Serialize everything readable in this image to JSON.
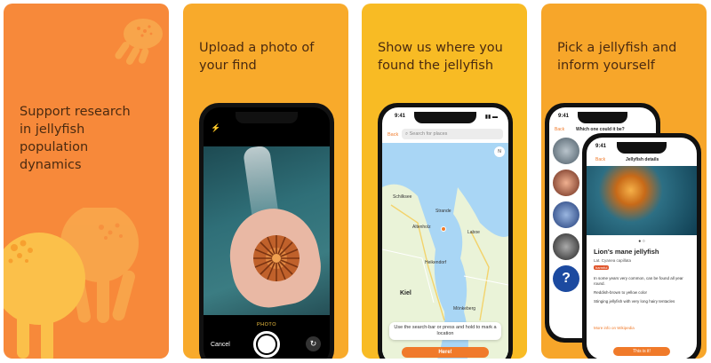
{
  "panel1": {
    "headline_lines": [
      "Support research",
      "in jellyfish",
      "population",
      "dynamics"
    ]
  },
  "panel2": {
    "headline_lines": [
      "Upload a photo of",
      "your find"
    ],
    "camera": {
      "mode_label": "PHOTO",
      "cancel_label": "Cancel",
      "flash_icon": "lightning-icon",
      "flip_icon": "camera-flip-icon"
    }
  },
  "panel3": {
    "headline_lines": [
      "Show us where you",
      "found the jellyfish"
    ],
    "status_time": "9:41",
    "back_label": "Back",
    "search_placeholder": "Search for places",
    "compass_label": "N",
    "map_labels": [
      "Schilksee",
      "Strande",
      "Altenholz",
      "Laboe",
      "Heikendorf",
      "Kiel",
      "Mönkeberg"
    ],
    "hint_text": "Use the search-bar or press and hold to mark a location",
    "here_button": "Here!"
  },
  "panel4": {
    "headline_lines": [
      "Pick a jellyfish and",
      "inform yourself"
    ],
    "back_phone": {
      "status_time": "9:41",
      "back_label": "Back",
      "title": "Which one could it be?"
    },
    "front_phone": {
      "status_time": "9:41",
      "back_label": "Back",
      "title": "Jellyfish details",
      "species_name": "Lion's mane jellyfish",
      "latin_name": "Lat. Cyanea capillata",
      "warning": "harmful",
      "facts": [
        "In some years very common, can be found all year round.",
        "Reddish-brown to yellow color",
        "Stinging jellyfish with very long hairy tentacles"
      ],
      "wiki_link": "More info on Wikipedia",
      "select_button": "This is it!"
    }
  },
  "colors": {
    "panel1": "#f7893a",
    "panel2": "#f8aa2b",
    "panel3": "#f8bb24",
    "panel4": "#f7a62a",
    "accent": "#f07a2a",
    "headline": "#4a2a10"
  }
}
